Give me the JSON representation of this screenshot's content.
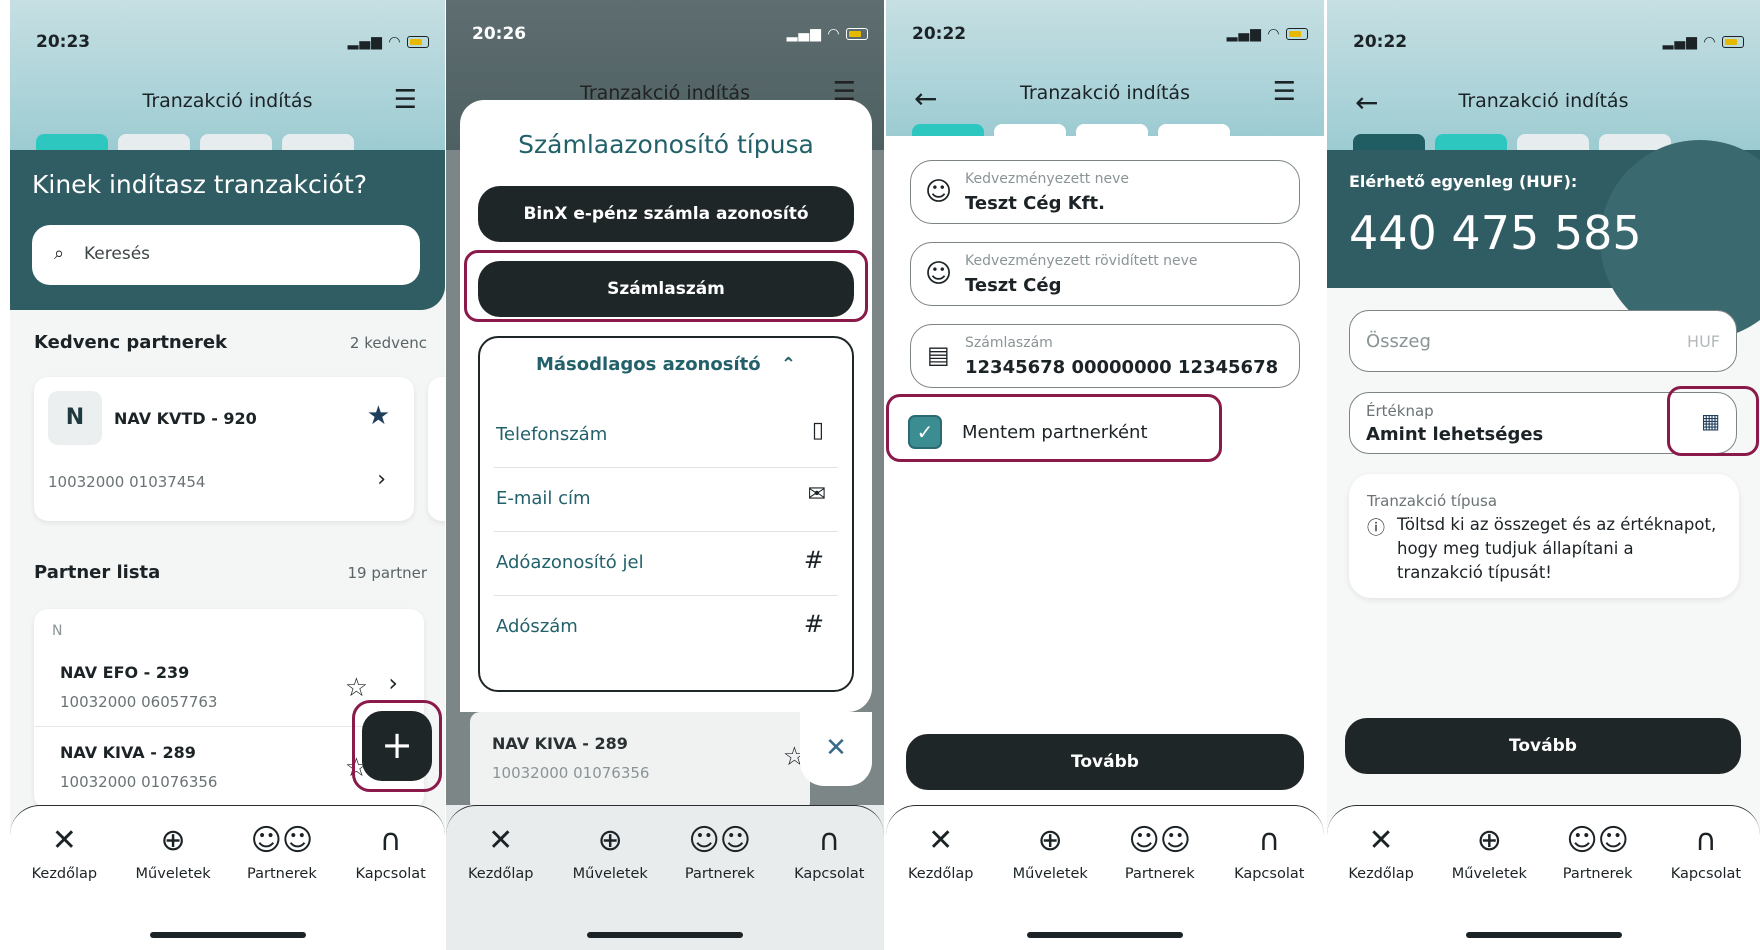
{
  "common": {
    "header_title": "Tranzakció indítás",
    "nav": [
      {
        "label": "Kezdőlap",
        "icon": "x-logo-icon"
      },
      {
        "label": "Műveletek",
        "icon": "plus-circle-icon"
      },
      {
        "label": "Partnerek",
        "icon": "partners-icon"
      },
      {
        "label": "Kapcsolat",
        "icon": "headset-icon"
      }
    ]
  },
  "screen1": {
    "time": "20:23",
    "heading": "Kinek indítasz tranzakciót?",
    "search_placeholder": "Keresés",
    "fav_title": "Kedvenc partnerek",
    "fav_count": "2 kedvenc",
    "fav_partner": {
      "initial": "N",
      "name": "NAV KVTD - 920",
      "account": "10032000 01037454"
    },
    "list_title": "Partner lista",
    "list_count": "19 partner",
    "list_letter": "N",
    "partners": [
      {
        "name": "NAV EFO - 239",
        "account": "10032000 06057763"
      },
      {
        "name": "NAV KIVA - 289",
        "account": "10032000 01076356"
      }
    ]
  },
  "screen2": {
    "time": "20:26",
    "sheet_title": "Számlaazonosító típusa",
    "opt1": "BinX e-pénz számla azonosító",
    "opt2": "Számlaszám",
    "secondary_title": "Másodlagos azonosító",
    "items": [
      {
        "label": "Telefonszám",
        "icon": "phone-icon"
      },
      {
        "label": "E-mail cím",
        "icon": "mail-icon"
      },
      {
        "label": "Adóazonosító jel",
        "icon": "hash-icon"
      },
      {
        "label": "Adószám",
        "icon": "hash-icon"
      }
    ],
    "behind_partner": {
      "name": "NAV KIVA - 289",
      "account": "10032000 01076356"
    }
  },
  "screen3": {
    "time": "20:22",
    "f1_label": "Kedvezményezett neve",
    "f1_value": "Teszt Cég Kft.",
    "f2_label": "Kedvezményezett rövidített neve",
    "f2_value": "Teszt Cég",
    "f3_label": "Számlaszám",
    "f3_value": "12345678 00000000 12345678",
    "save_label": "Mentem partnerként",
    "next": "Tovább"
  },
  "screen4": {
    "time": "20:22",
    "balance_label": "Elérhető egyenleg (HUF):",
    "balance": "440 475 585",
    "amount_placeholder": "Összeg",
    "currency": "HUF",
    "date_label": "Értéknap",
    "date_value": "Amint lehetséges",
    "type_label": "Tranzakció típusa",
    "type_info": "Töltsd ki az összeget és az értéknapot, hogy meg tudjuk állapítani a tranzakció típusát!",
    "next": "Tovább"
  }
}
